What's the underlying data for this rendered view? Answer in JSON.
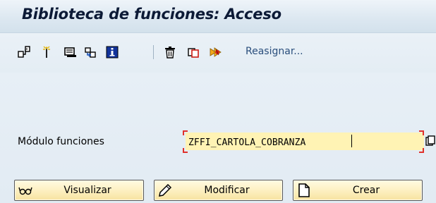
{
  "window": {
    "title": "Biblioteca de funciones: Acceso"
  },
  "toolbar": {
    "icons": [
      "other-object-icon",
      "check-icon",
      "where-used-icon",
      "copy-icon",
      "info-icon",
      "delete-icon",
      "rename-icon",
      "test-icon"
    ],
    "reassign_label": "Reasignar..."
  },
  "form": {
    "field_label": "Módulo funciones",
    "field_value": "ZFFI_CARTOLA_COBRANZA"
  },
  "buttons": {
    "display_label": "Visualizar",
    "change_label": "Modificar",
    "create_label": "Crear"
  },
  "colors": {
    "input_background": "#fff3b4",
    "required_marker": "#e0312b",
    "button_gradient_top": "#fffbe2",
    "button_gradient_bottom": "#f7e3a0"
  }
}
